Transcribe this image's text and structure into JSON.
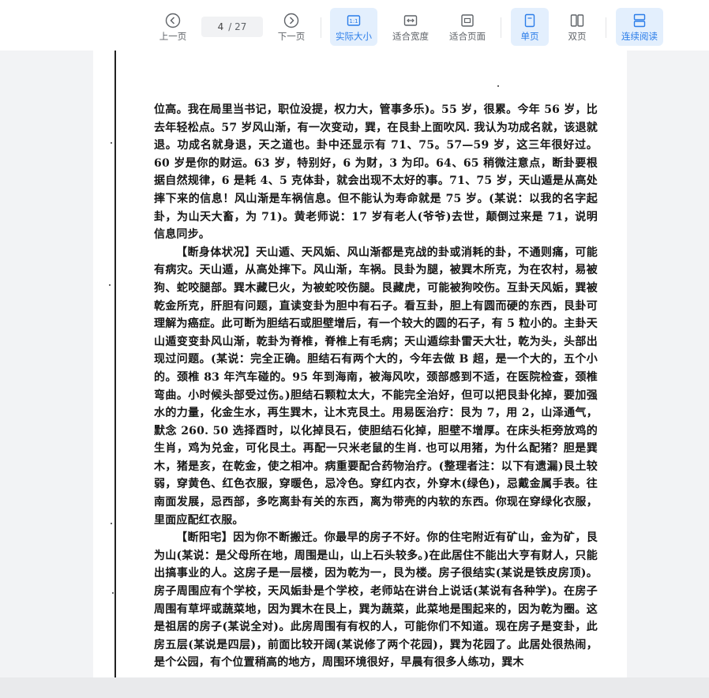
{
  "toolbar": {
    "prev_label": "上一页",
    "next_label": "下一页",
    "current_page": "4",
    "total_pages": "/ 27",
    "actual_size_label": "实际大小",
    "fit_width_label": "适合宽度",
    "fit_page_label": "适合页面",
    "single_page_label": "单页",
    "double_page_label": "双页",
    "continuous_label": "连续阅读",
    "active_color": "#2b7de9"
  },
  "document": {
    "paragraphs": [
      "位高。我在局里当书记，职位没提，权力大，管事多乐)。55 岁，很累。今年 56 岁，比去年轻松点。57 岁风山渐，有一次变动，巽，在艮卦上面吹风. 我认为功成名就，该退就退。功成名就身退，天之道也。卦中还显示有 71、75。57—59 岁，这三年很好过。60 岁是你的财运。63 岁，特别好，6 为财，3 为印。64、65 稍微注意点，断卦要根据自然规律，6 是耗 4、5 克体卦，就会出现不太好的事。71、75 岁，天山遁是从高处摔下来的信息！风山渐是车祸信息。但不能认为寿命就是 75 岁。(某说：以我的名字起卦，为山天大畜，为 71)。黄老师说：17 岁有老人(爷爷)去世，颠倒过来是 71，说明信息同步。",
      "【断身体状况】天山遁、天风姤、风山渐都是克战的卦或消耗的卦，不通则痛，可能有病灾。天山遁，从高处摔下。风山渐，车祸。艮卦为腿，被巽木所克，为在农村，易被狗、蛇咬腿部。巽木藏巳火，为被蛇咬伤腿。艮藏虎，可能被狗咬伤。互卦天风姤，巽被乾金所克，肝胆有问题，直读变卦为胆中有石子。看互卦，胆上有圆而硬的东西，艮卦可理解为癌症。此可断为胆结石或胆壁增后，有一个较大的圆的石子，有 5 粒小的。主卦天山遁变变卦风山渐，乾卦为脊椎，脊椎上有毛病；天山遁综卦雷天大壮，乾为头，头部出现过问题。(某说：完全正确。胆结石有两个大的，今年去做 B 超，是一个大的，五个小的。颈椎 83 年汽车碰的。95 年到海南，被海风吹，颈部感到不适，在医院检查，颈椎弯曲。小时候头部受过伤。)胆结石颗粒太大，不能完全治好，但可以把艮卦化掉，要加强水的力量，化金生水，再生巽木，让木克艮土。用易医治疗：艮为 7，用 2，山泽通气，默念 260. 50 选择酉时，以化掉艮石，使胆结石化掉，胆壁不增厚。在床头柜旁放鸡的生肖，鸡为兑金，可化艮土。再配一只米老鼠的生肖. 也可以用猪，为什么配猪？胆是巽木，猪是亥，在乾金，使之相冲。病重要配合药物治疗。(整理者注：以下有遗漏)艮土较弱，穿黄色、红色衣服，穿暖色，忌冷色。穿红内衣，外穿木(绿色)，忌戴金属手表。往南面发展，忌西部，多吃离卦有关的东西，离为带壳的内软的东西。你现在穿绿化衣服，里面应配红衣服。",
      "【断阳宅】因为你不断搬迁。你最早的房子不好。你的住宅附近有矿山，金为矿，艮为山(某说：是父母所在地，周围是山，山上石头较多。)在此居住不能出大亨有财人，只能出搞事业的人。这房子是一层楼，因为乾为一，艮为楼。房子很结实(某说是铁皮房顶)。房子周围应有个学校，天风姤卦是个学校，老师站在讲台上说话(某说有各种学)。在房子周围有草坪或蔬菜地，因为巽木在艮上，巽为蔬菜，此菜地是围起来的，因为乾为圈。这是祖居的房子(某说全对)。此房周围有有权的人，可能你们不知道。现在房子是变卦，此房五层(某说是四层)，前面比较开阔(某说修了两个花园)，巽为花园了。此居处很热闹，是个公园，有个位置稍高的地方，周围环境很好，早晨有很多人练功，巽木"
    ]
  }
}
